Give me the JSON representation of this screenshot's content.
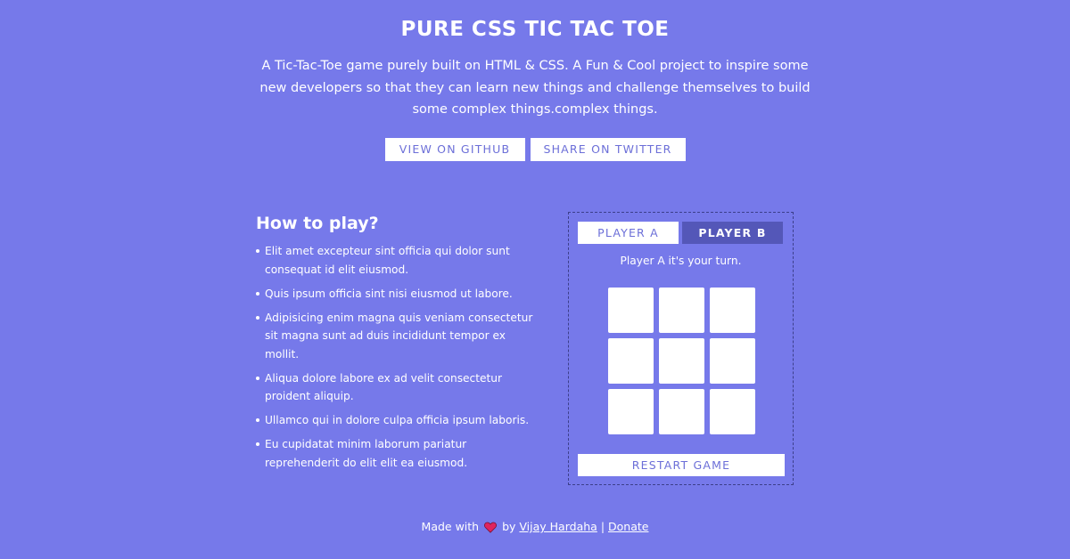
{
  "header": {
    "title": "PURE CSS TIC TAC TOE",
    "intro": "A Tic-Tac-Toe game purely built on HTML & CSS. A Fun & Cool project to inspire some new developers so that they can learn new things and challenge themselves to build some complex things.complex things.",
    "github_label": "VIEW ON GITHUB",
    "twitter_label": "SHARE ON TWITTER"
  },
  "how_to_play": {
    "title": "How to play?",
    "rules": [
      "Elit amet excepteur sint officia qui dolor sunt consequat id elit eiusmod.",
      "Quis ipsum officia sint nisi eiusmod ut labore.",
      "Adipisicing enim magna quis veniam consectetur sit magna sunt ad duis incididunt tempor ex mollit.",
      "Aliqua dolore labore ex ad velit consectetur proident aliquip.",
      "Ullamco qui in dolore culpa officia ipsum laboris.",
      "Eu cupidatat minim laborum pariatur reprehenderit do elit elit ea eiusmod."
    ]
  },
  "game": {
    "player_a": "PLAYER A",
    "player_b": "PLAYER B",
    "active_player": "PLAYER B",
    "turn_text": "Player A it's your turn.",
    "restart_label": "RESTART GAME"
  },
  "footer": {
    "made_with": "Made with",
    "heart_icon": "heart-icon",
    "by": "by",
    "author": "Vijay Hardaha",
    "separator": "|",
    "donate": "Donate"
  },
  "colors": {
    "background": "#7679ea",
    "button_text": "#6c6fd8",
    "active_tab": "#5457b8",
    "heart": "#e0245e"
  }
}
